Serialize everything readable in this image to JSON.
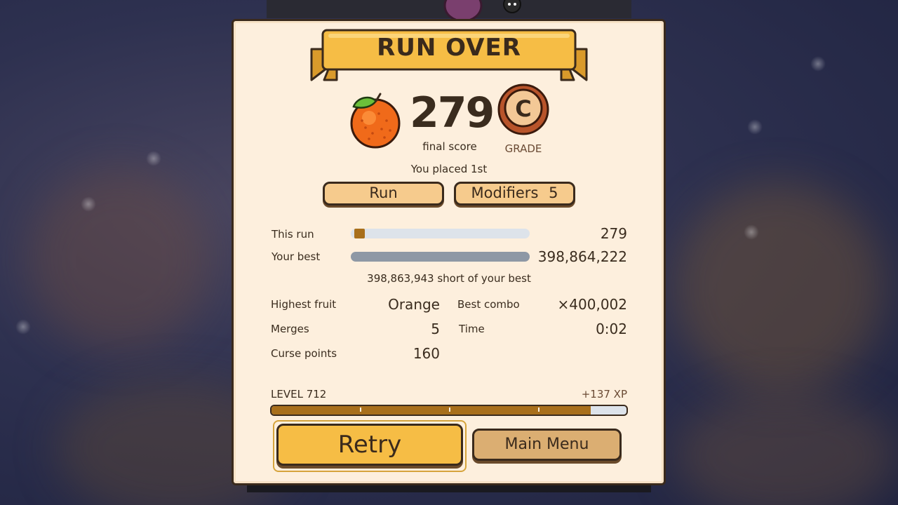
{
  "header": {
    "title": "RUN OVER"
  },
  "result": {
    "fruit_icon": "orange-icon",
    "score": "279",
    "score_label": "final score",
    "grade": "C",
    "grade_label": "GRADE",
    "placement_text": "You placed 1st"
  },
  "tabs": {
    "run_label": "Run",
    "modifiers_label": "Modifiers",
    "modifiers_count": "5"
  },
  "comparison": {
    "this_run_label": "This run",
    "this_run_value": "279",
    "this_run_fraction": 7e-07,
    "best_label": "Your best",
    "best_value": "398,864,222",
    "best_fraction": 1.0,
    "short_text": "398,863,943 short of your best"
  },
  "stats": {
    "highest_fruit_label": "Highest fruit",
    "highest_fruit_value": "Orange",
    "best_combo_label": "Best combo",
    "best_combo_value": "×400,002",
    "merges_label": "Merges",
    "merges_value": "5",
    "time_label": "Time",
    "time_value": "0:02",
    "curse_points_label": "Curse points",
    "curse_points_value": "160"
  },
  "progress": {
    "level_label": "LEVEL 712",
    "xp_gain": "+137 XP",
    "xp_fraction": 0.9
  },
  "actions": {
    "retry_label": "Retry",
    "main_menu_label": "Main Menu"
  },
  "colors": {
    "panel_bg": "#fdefdd",
    "accent_gold": "#f6bd45",
    "bar_brown": "#a86f1b",
    "outline_dark": "#3a2a1c"
  }
}
